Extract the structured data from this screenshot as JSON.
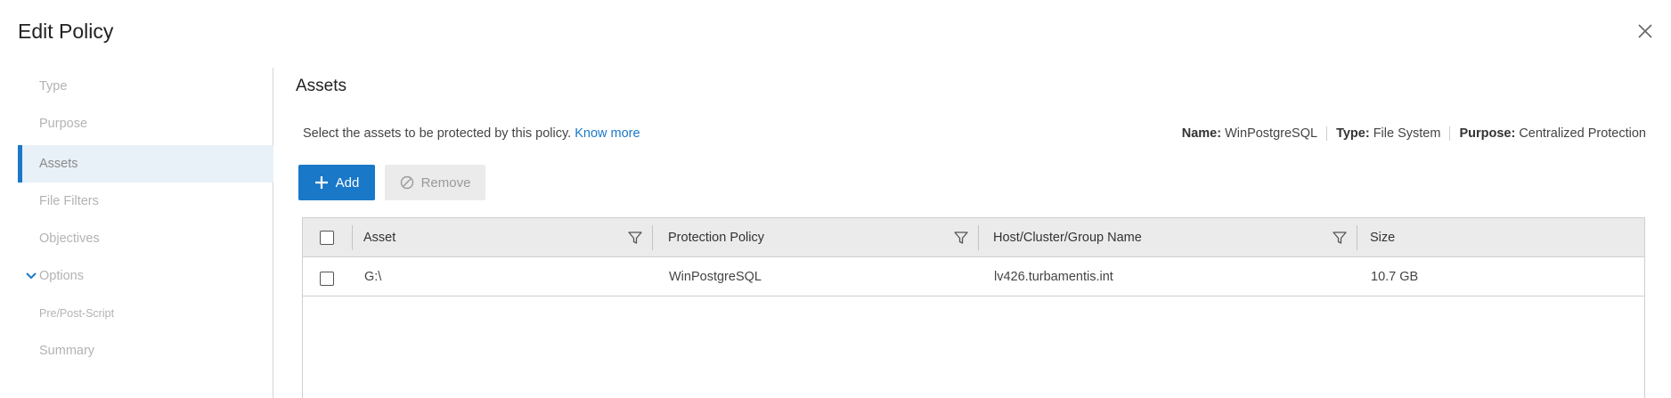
{
  "dialog": {
    "title": "Edit Policy"
  },
  "icons": {
    "close": "close-icon",
    "chevron": "chevron-down-icon",
    "add": "plus-icon",
    "remove": "disabled-icon",
    "filter": "filter-icon"
  },
  "colors": {
    "accent": "#1a78c8",
    "active_bg": "#e8f0f8",
    "header_bg": "#ebebeb"
  },
  "steps": [
    {
      "label": "Type"
    },
    {
      "label": "Purpose"
    },
    {
      "label": "Assets"
    },
    {
      "label": "File Filters"
    },
    {
      "label": "Objectives"
    },
    {
      "label": "Options"
    },
    {
      "label": "Pre/Post-Script"
    },
    {
      "label": "Summary"
    }
  ],
  "section": {
    "title": "Assets",
    "description": "Select the assets to be protected by this policy.",
    "know_more": "Know more"
  },
  "summary": {
    "name_label": "Name:",
    "name_value": "WinPostgreSQL",
    "type_label": "Type:",
    "type_value": "File System",
    "purpose_label": "Purpose:",
    "purpose_value": "Centralized Protection"
  },
  "toolbar": {
    "add_label": "Add",
    "remove_label": "Remove"
  },
  "table": {
    "columns": [
      "Asset",
      "Protection Policy",
      "Host/Cluster/Group Name",
      "Size"
    ],
    "rows": [
      {
        "asset": "G:\\",
        "policy": "WinPostgreSQL",
        "host": "lv426.turbamentis.int",
        "size": "10.7 GB"
      }
    ]
  }
}
